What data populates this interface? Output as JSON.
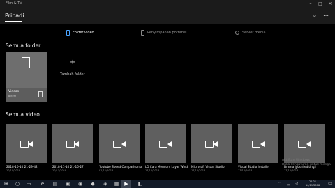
{
  "window": {
    "app_name": "Film & TV"
  },
  "header": {
    "title": "Pribadi"
  },
  "tabs": [
    {
      "label": "Folder video",
      "active": true
    },
    {
      "label": "Penyimpanan portabel",
      "active": false
    },
    {
      "label": "Server media",
      "active": false
    }
  ],
  "folders_section": {
    "title": "Semua folder",
    "folder": {
      "name": "Videos",
      "meta": "8 item"
    },
    "add_label": "Tambah folder"
  },
  "videos_section": {
    "title": "Semua video",
    "items": [
      {
        "name": "2018-10-10 21-29-42",
        "date": "10/10/2018"
      },
      {
        "name": "2018-11-10 21-16-27",
        "date": "10/11/2018"
      },
      {
        "name": "Youtube Speed Comparison and Quality",
        "date": "01/11/2018"
      },
      {
        "name": "LO Cara Mendum Layar Windows 10 Tanpa Aplikasi",
        "date": "17/10/2018"
      },
      {
        "name": "Microsoft Visual Studio",
        "date": "17/10/2018"
      },
      {
        "name": "Visual Studio installer",
        "date": "17/10/2018"
      },
      {
        "name": "Drama jyoshi editing2",
        "date": "17/10/2018"
      }
    ]
  },
  "watermark": {
    "line1": "Aktifkan Windows",
    "line2": "Buka Pengaturan untuk mengaktifkan Windows."
  },
  "taskbar": {
    "time": "21:21",
    "date": "10/11/2018"
  }
}
